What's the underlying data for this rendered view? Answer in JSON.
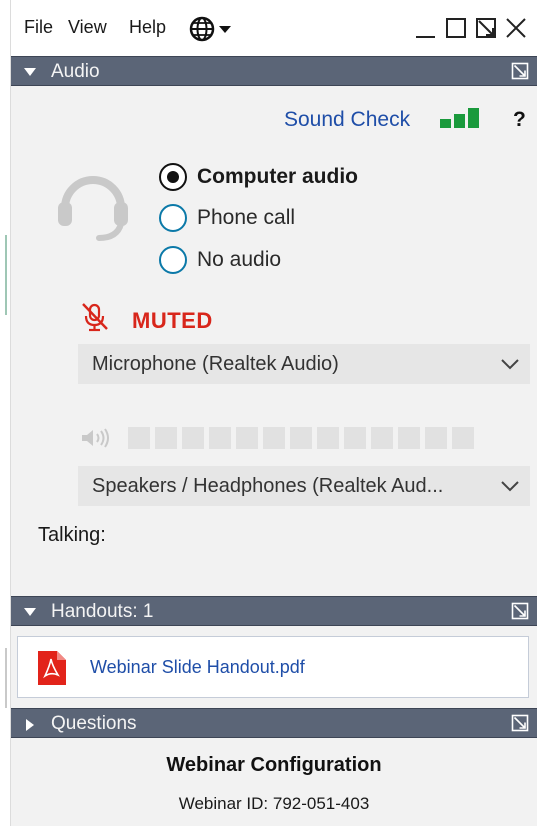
{
  "menu": {
    "file": "File",
    "view": "View",
    "help": "Help"
  },
  "icons": {
    "language": "globe-icon",
    "minimize": "minimize-icon",
    "maximize": "maximize-icon",
    "float": "popout-icon",
    "close": "close-icon"
  },
  "audio": {
    "header": "Audio",
    "sound_check": "Sound Check",
    "help": "?",
    "options": [
      {
        "label": "Computer audio",
        "selected": true
      },
      {
        "label": "Phone call",
        "selected": false
      },
      {
        "label": "No audio",
        "selected": false
      }
    ],
    "muted_label": "MUTED",
    "microphone": "Microphone (Realtek Audio)",
    "speaker_level_segments": 13,
    "speakers": "Speakers / Headphones (Realtek Aud...",
    "talking": "Talking:"
  },
  "handouts": {
    "header": "Handouts: 1",
    "items": [
      {
        "name": "Webinar Slide Handout.pdf"
      }
    ]
  },
  "questions": {
    "header": "Questions"
  },
  "config": {
    "title": "Webinar Configuration",
    "webinar_id": "Webinar ID: 792-051-403"
  },
  "colors": {
    "header_bg": "#5b6577",
    "link": "#1f4ea8",
    "muted": "#d8261b",
    "signal": "#1a9a3c",
    "radio_border": "#0b79a8"
  }
}
